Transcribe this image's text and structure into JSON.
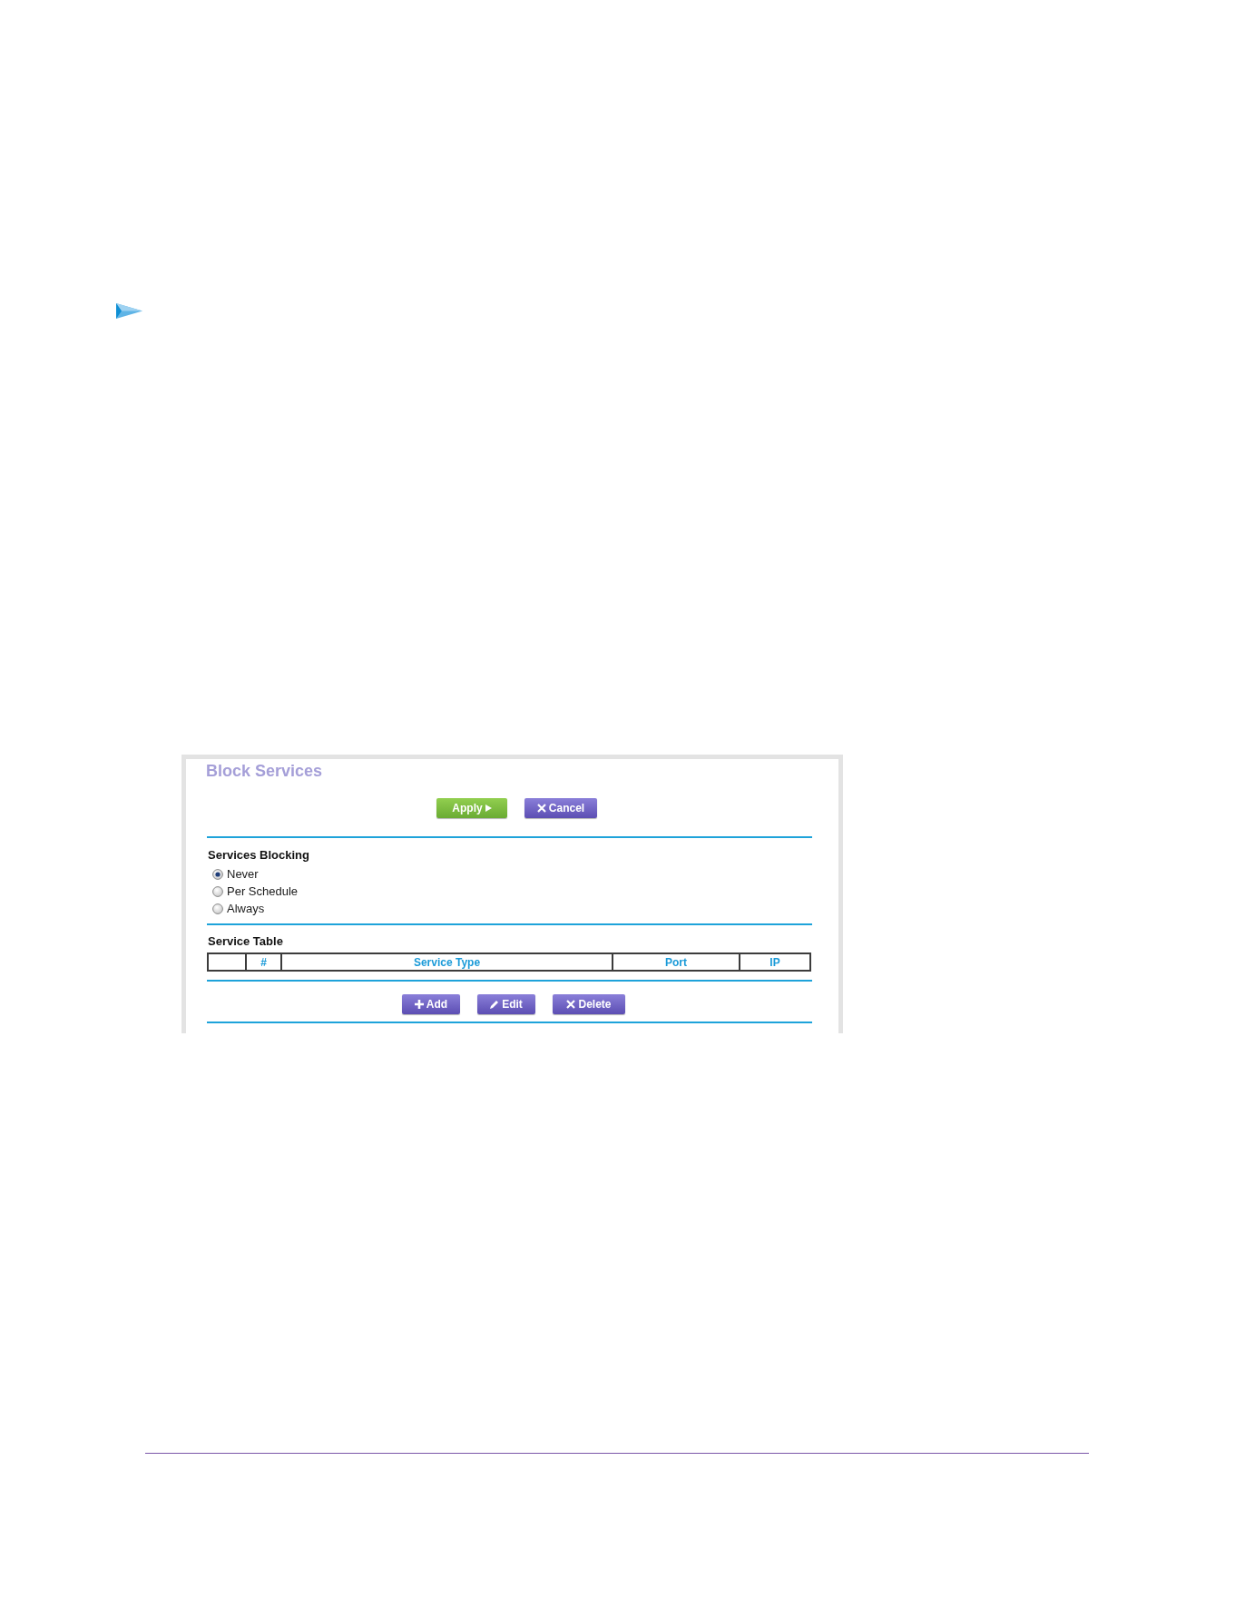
{
  "panel": {
    "title": "Block Services",
    "buttons": [
      {
        "label": "Apply",
        "kind": "apply"
      },
      {
        "label": "Cancel",
        "kind": "cancel"
      }
    ],
    "services_blocking": {
      "heading": "Services Blocking",
      "options": [
        {
          "label": "Never",
          "selected": true
        },
        {
          "label": "Per Schedule",
          "selected": false
        },
        {
          "label": "Always",
          "selected": false
        }
      ]
    },
    "service_table": {
      "heading": "Service Table",
      "columns": [
        {
          "kind": "blank"
        },
        {
          "kind": "label",
          "label": "#"
        },
        {
          "kind": "label",
          "label": "Service Type"
        },
        {
          "kind": "label",
          "label": "Port"
        },
        {
          "kind": "label",
          "label": "IP"
        }
      ]
    },
    "table_buttons": [
      {
        "label": "Add",
        "kind": "add"
      },
      {
        "label": "Edit",
        "kind": "edit"
      },
      {
        "label": "Delete",
        "kind": "delete"
      }
    ]
  }
}
